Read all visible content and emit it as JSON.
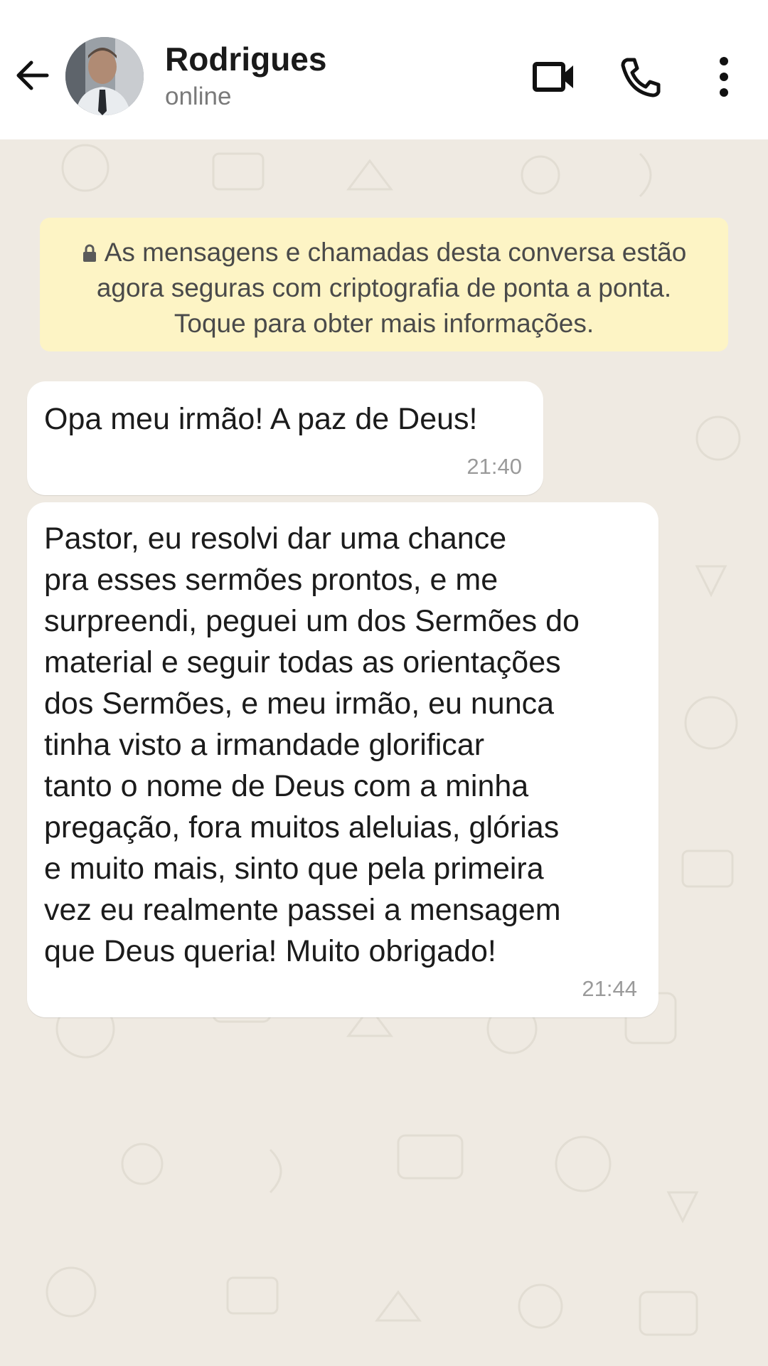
{
  "header": {
    "contact_name": "Rodrigues",
    "status": "online",
    "icons": {
      "back": "arrow-left-icon",
      "avatar": "contact-avatar",
      "video": "video-camera-icon",
      "call": "phone-icon",
      "menu": "more-vertical-icon"
    }
  },
  "encryption_notice": {
    "icon": "lock-icon",
    "text": "As mensagens e chamadas desta conversa estão agora seguras com criptografia de ponta a ponta. Toque para obter mais informações."
  },
  "messages": [
    {
      "text": "Opa meu irmão! A paz de Deus!",
      "time": "21:40"
    },
    {
      "text": "Pastor, eu resolvi dar uma chance\npra esses sermões prontos, e me\nsurpreendi, peguei um dos Sermões do\nmaterial e seguir todas as orientações\ndos Sermões, e meu irmão, eu nunca\ntinha visto a irmandade glorificar\ntanto o nome de Deus com a minha\npregação, fora muitos aleluias, glórias\ne muito mais, sinto que pela primeira\nvez eu realmente passei a mensagem\nque Deus queria! Muito obrigado!",
      "time": "21:44"
    }
  ],
  "colors": {
    "chat_background": "#efeae2",
    "notice_background": "#fdf4c5",
    "bubble_background": "#ffffff",
    "header_background": "#ffffff"
  }
}
